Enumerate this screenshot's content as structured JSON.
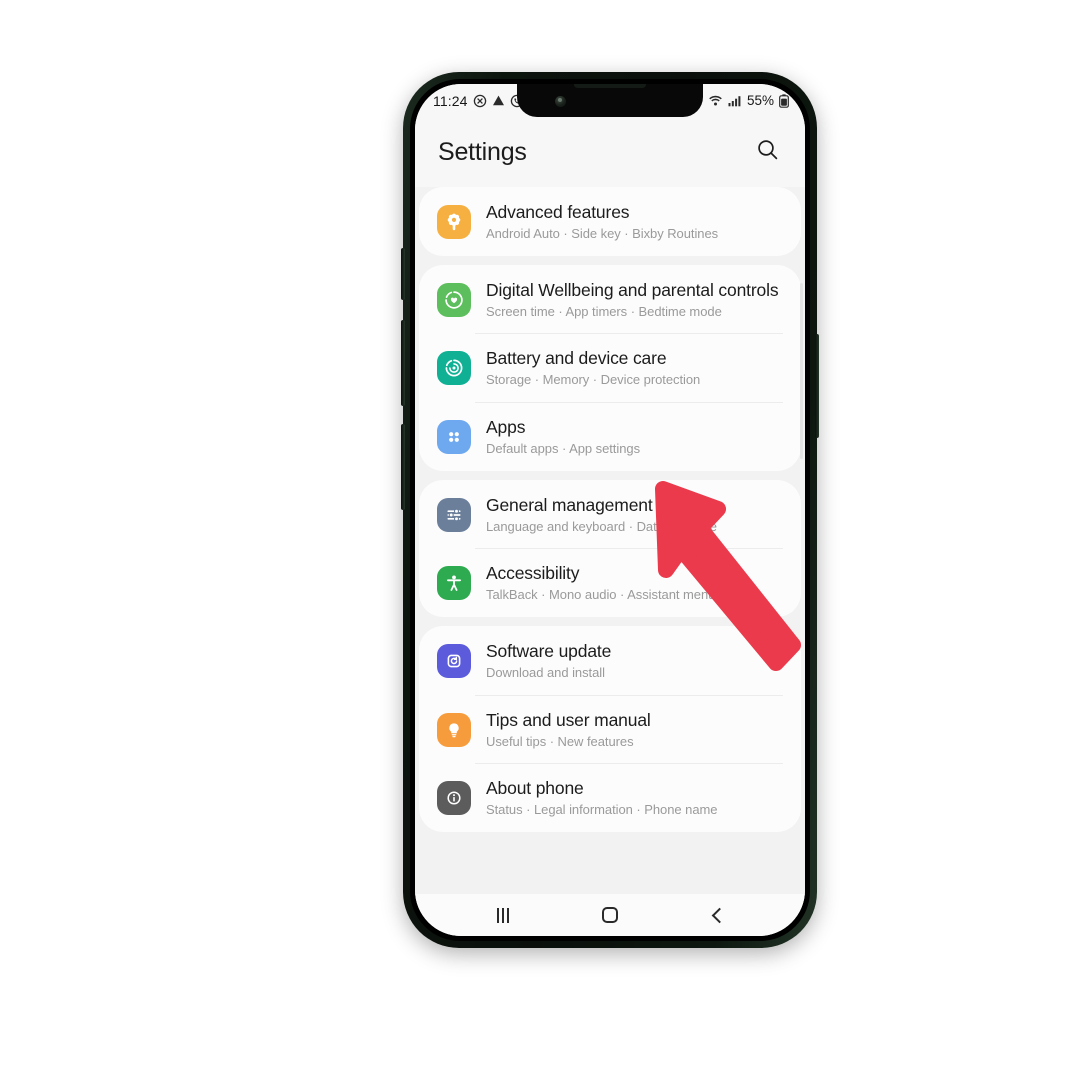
{
  "device": {
    "frame_color": "#0c140e",
    "type": "smartphone"
  },
  "status_bar": {
    "time": "11:24",
    "left_icons": [
      "mute-icon",
      "warning-triangle-icon",
      "call-mute-icon"
    ],
    "right_icons": [
      "wifi-icon",
      "signal-bars-icon"
    ],
    "battery_percent": "55%",
    "battery_icon": "battery-icon"
  },
  "header": {
    "title": "Settings",
    "search_icon": "search-icon"
  },
  "groups": [
    {
      "items": [
        {
          "title": "Advanced features",
          "subtitle": "Android Auto  ·  Side key  ·  Bixby Routines",
          "icon": "advanced-features-icon",
          "icon_color": "#f6b042"
        }
      ]
    },
    {
      "items": [
        {
          "title": "Digital Wellbeing and parental controls",
          "subtitle": "Screen time  ·  App timers  ·  Bedtime mode",
          "icon": "digital-wellbeing-icon",
          "icon_color": "#5cbe5c"
        },
        {
          "title": "Battery and device care",
          "subtitle": "Storage  ·  Memory  ·  Device protection",
          "icon": "battery-device-care-icon",
          "icon_color": "#10b094"
        },
        {
          "title": "Apps",
          "subtitle": "Default apps  ·  App settings",
          "icon": "apps-icon",
          "icon_color": "#6ea8ef"
        }
      ]
    },
    {
      "items": [
        {
          "title": "General management",
          "subtitle": "Language and keyboard  ·  Date and time",
          "icon": "general-management-icon",
          "icon_color": "#6b7f9b"
        },
        {
          "title": "Accessibility",
          "subtitle": "TalkBack  ·  Mono audio  ·  Assistant menu",
          "icon": "accessibility-icon",
          "icon_color": "#2eab50"
        }
      ]
    },
    {
      "items": [
        {
          "title": "Software update",
          "subtitle": "Download and install",
          "icon": "software-update-icon",
          "icon_color": "#5b5bdc"
        },
        {
          "title": "Tips and user manual",
          "subtitle": "Useful tips  ·  New features",
          "icon": "tips-lightbulb-icon",
          "icon_color": "#f79c3c"
        },
        {
          "title": "About phone",
          "subtitle": "Status  ·  Legal information  ·  Phone name",
          "icon": "about-phone-icon",
          "icon_color": "#5c5c5c"
        }
      ]
    }
  ],
  "nav_bar": {
    "recents_label": "recents-icon",
    "home_label": "home-icon",
    "back_label": "back-icon"
  },
  "annotation": {
    "arrow_color": "#ea3a4c",
    "points_to": "Apps"
  }
}
